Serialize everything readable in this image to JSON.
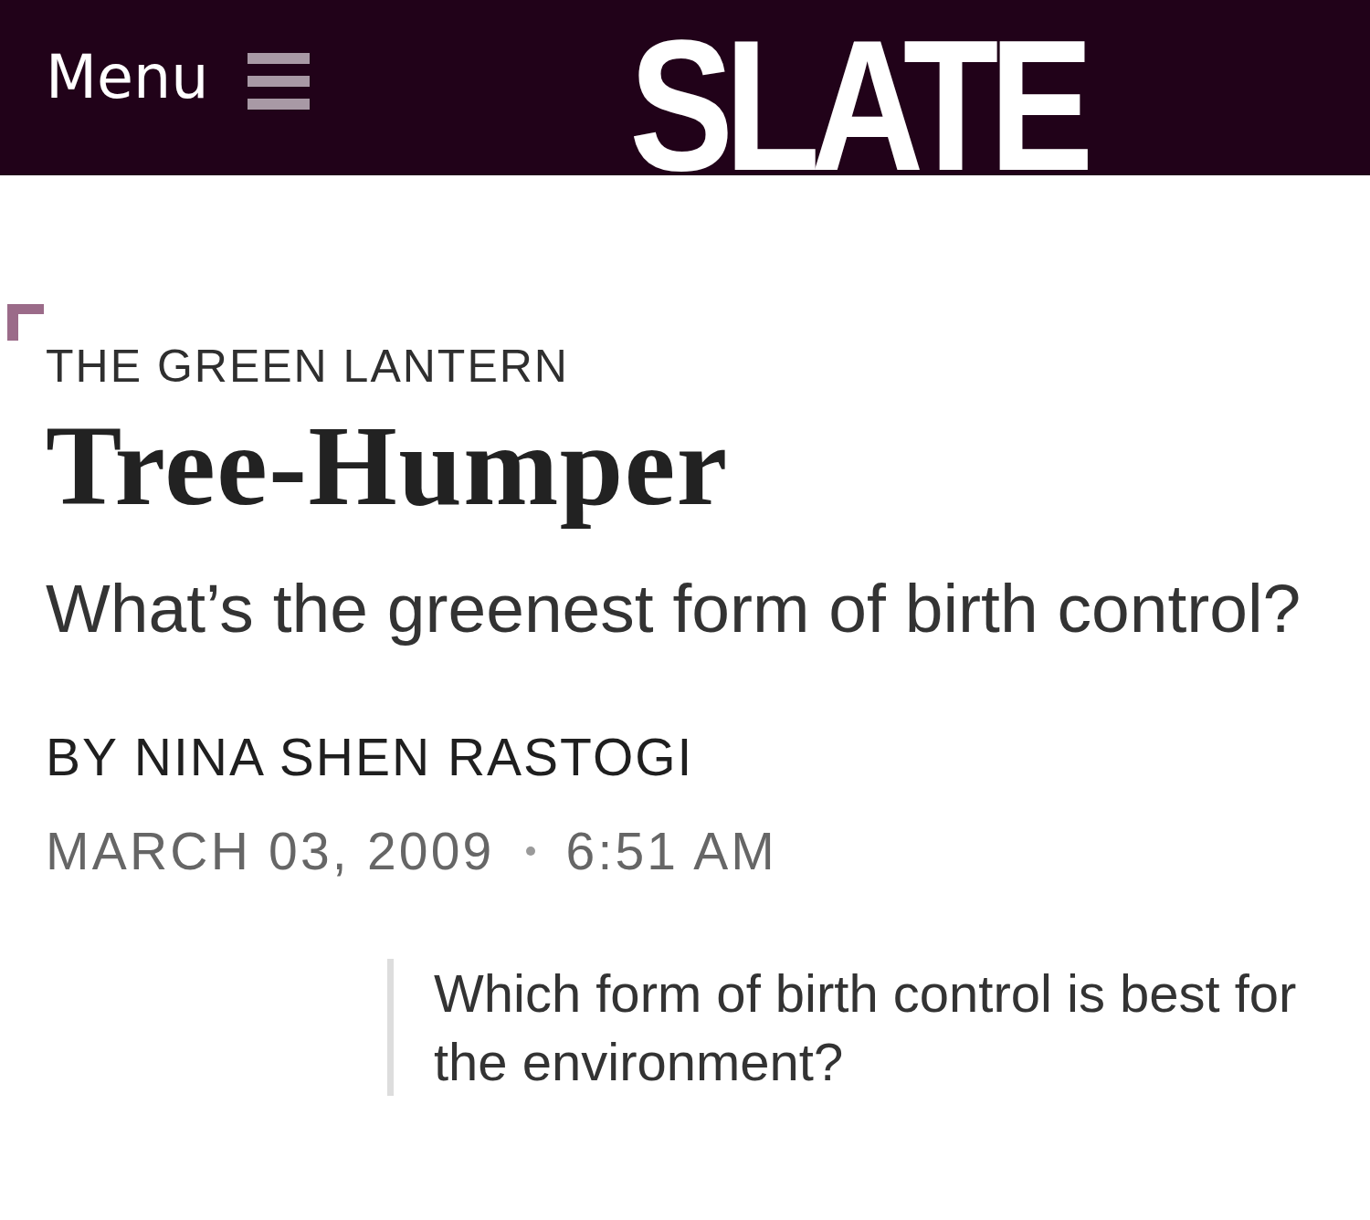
{
  "header": {
    "menu_button": {
      "label": "Menu"
    },
    "logo": "SLATE"
  },
  "article": {
    "kicker": "THE GREEN LANTERN",
    "title": "Tree-Humper",
    "subtitle": "What’s the greenest form of birth control?",
    "byline": "BY NINA SHEN RASTOGI",
    "date": "MARCH 03, 2009",
    "time": "6:51 AM",
    "summary": "Which form of birth control is best for the environment?"
  }
}
